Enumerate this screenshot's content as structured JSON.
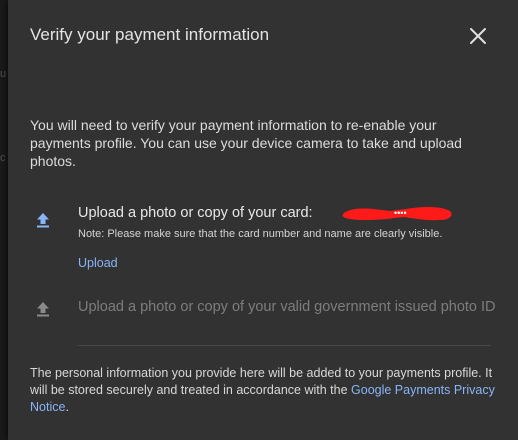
{
  "background": {
    "edge_chars": [
      "u",
      "c"
    ]
  },
  "dialog": {
    "title": "Verify your payment information",
    "close_icon": "close-icon",
    "intro": "You will need to verify your payment information to re-enable your payments profile. You can use your device camera to take and upload photos.",
    "card_upload": {
      "icon": "upload-icon",
      "title": "Upload a photo or copy of your card:",
      "masked_number": "••••",
      "note": "Note: Please make sure that the card number and name are clearly visible.",
      "upload_label": "Upload"
    },
    "id_upload": {
      "icon": "upload-icon",
      "title": "Upload a photo or copy of your valid government issued photo ID"
    },
    "footer": {
      "text": "The personal information you provide here will be added to your payments profile. It will be stored securely and treated in accordance with the ",
      "link": "Google Payments Privacy Notice",
      "suffix": "."
    }
  },
  "colors": {
    "dialog_bg": "#323232",
    "link": "#8ab4f8",
    "icon_active": "#8ab4f8",
    "icon_disabled": "#8a8a8a",
    "redaction": "#ff0000"
  }
}
